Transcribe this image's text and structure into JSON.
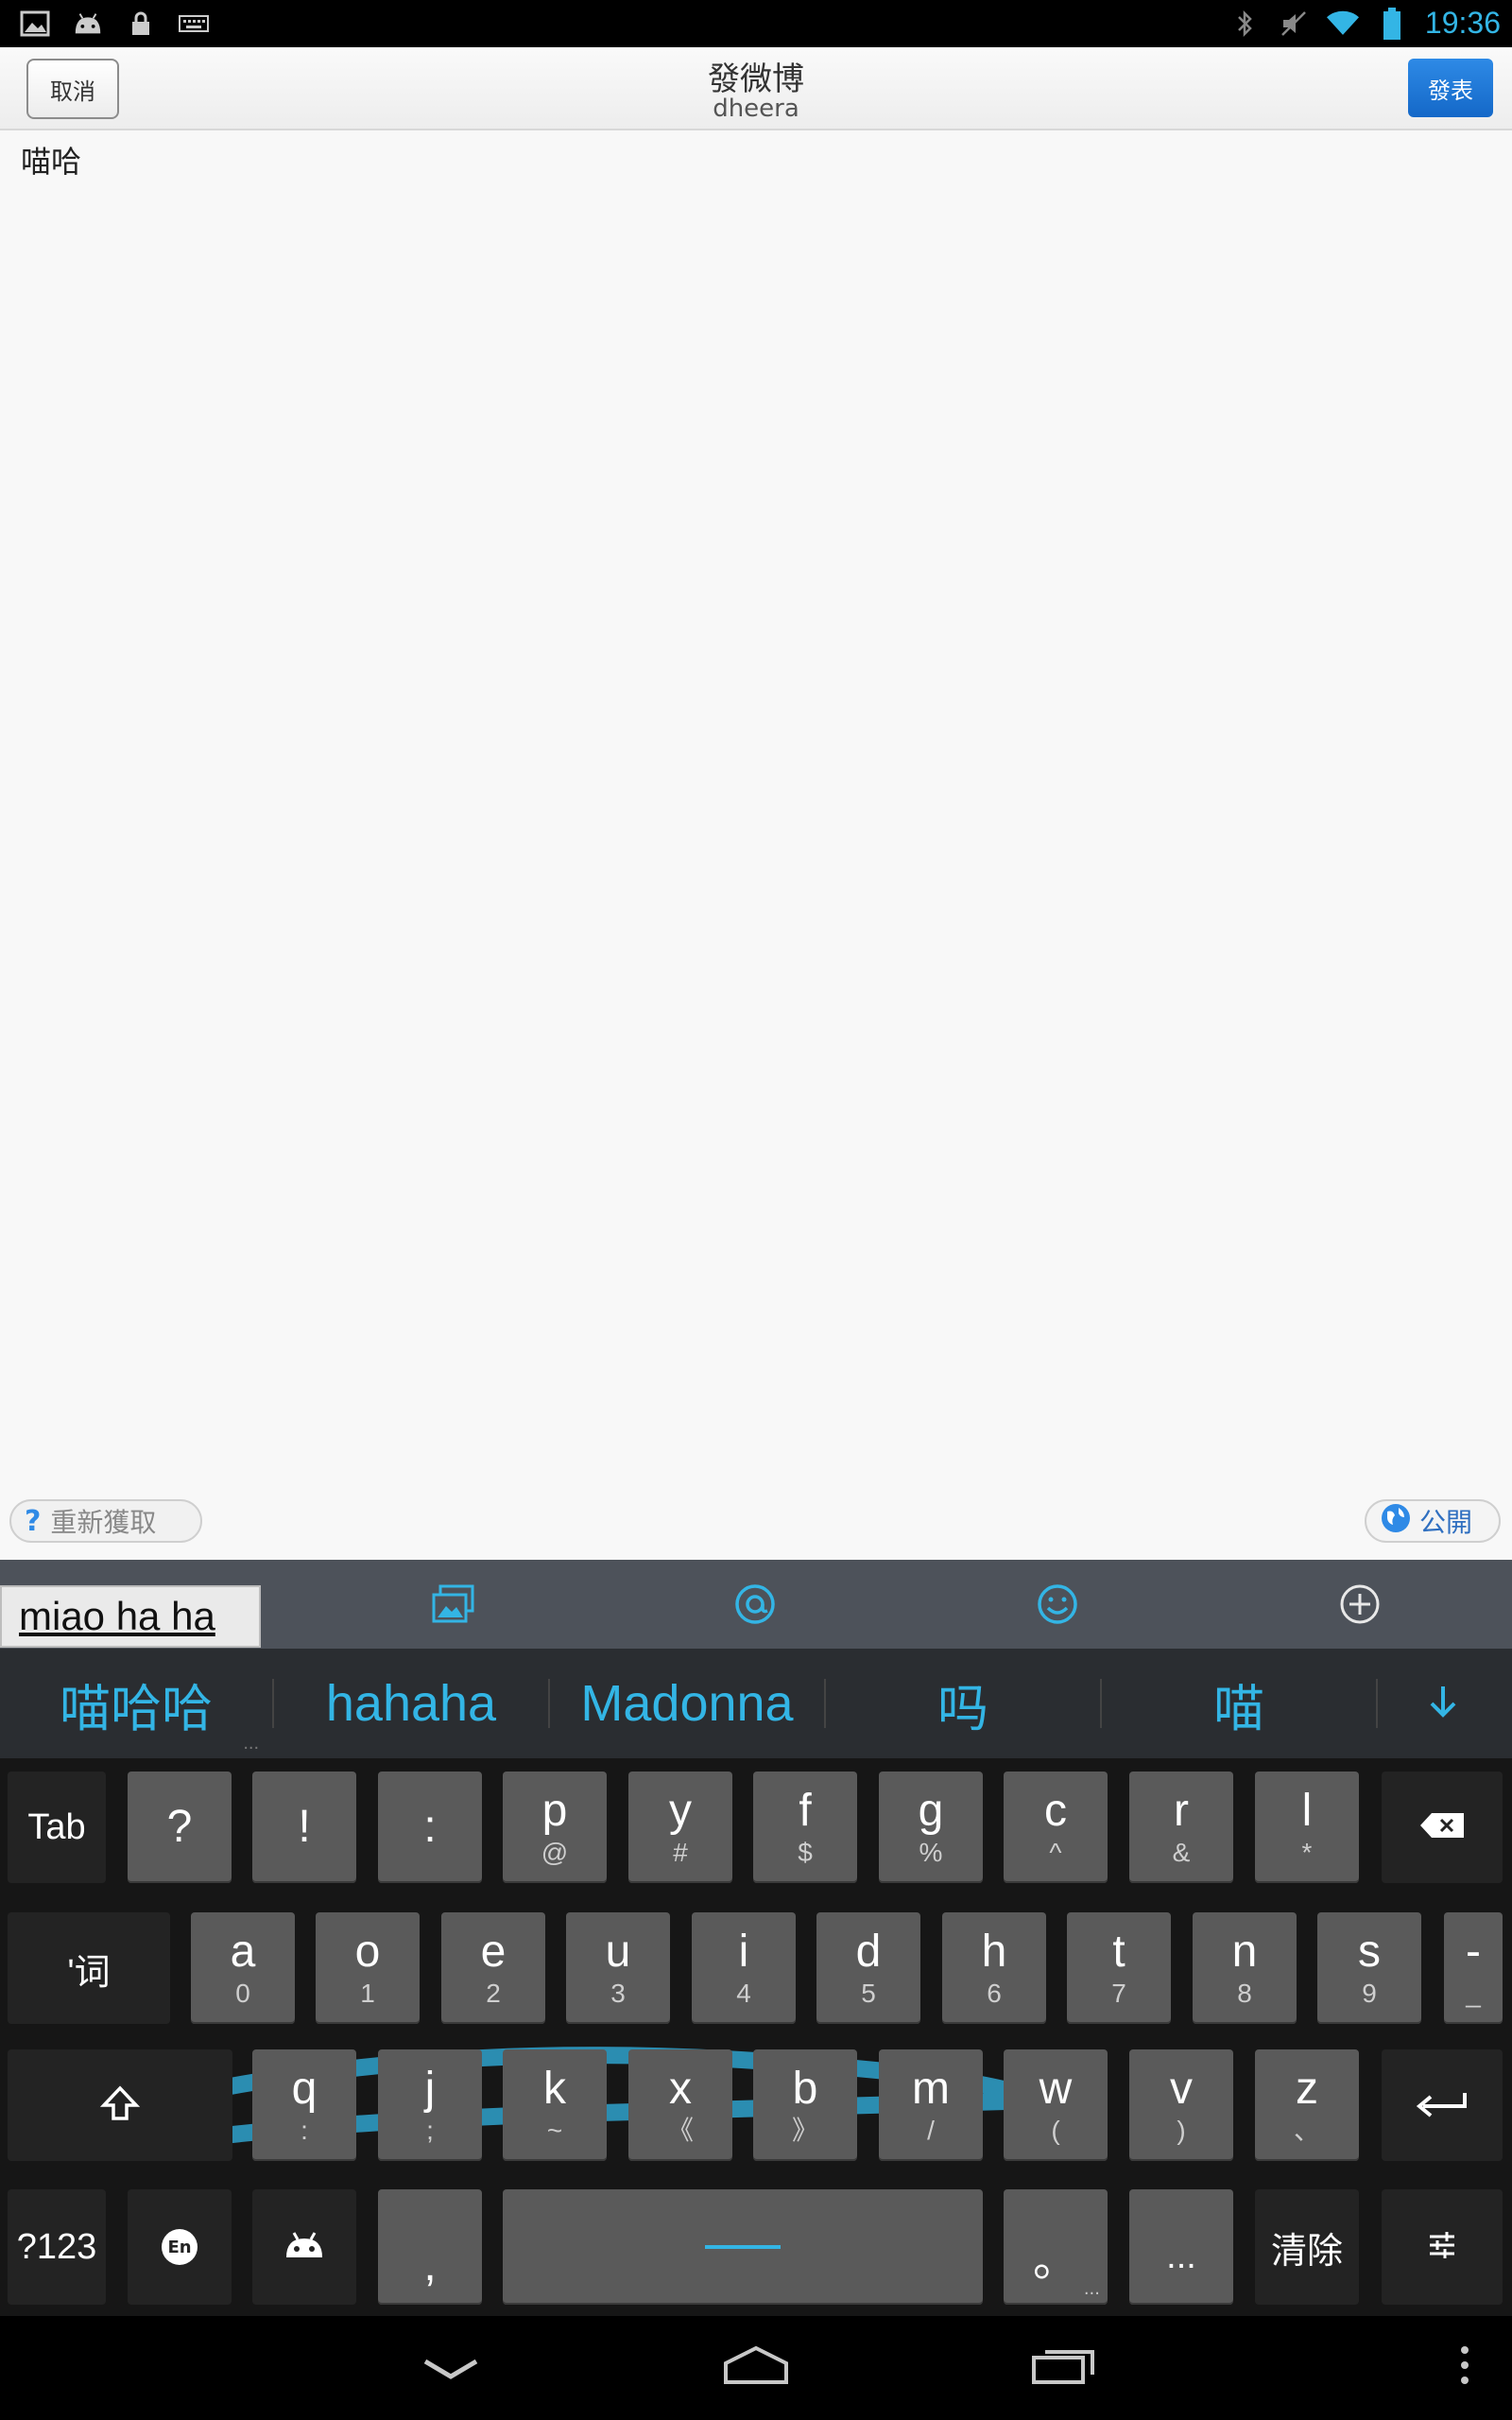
{
  "status_bar": {
    "time": "19:36",
    "left_icons": [
      "gallery-icon",
      "android-icon",
      "lock-icon",
      "keyboard-icon"
    ],
    "right_icons": [
      "bluetooth-icon",
      "mute-icon",
      "wifi-icon",
      "battery-icon"
    ]
  },
  "action_bar": {
    "cancel_label": "取消",
    "title": "發微博",
    "subtitle": "dheera",
    "post_label": "發表"
  },
  "compose": {
    "text": "喵哈"
  },
  "footer": {
    "refetch_label": "重新獲取",
    "visibility_label": "公開"
  },
  "toolbar": {
    "composing_text": "miao ha ha",
    "icons": [
      "image-icon",
      "at-icon",
      "emoji-icon",
      "plus-icon"
    ]
  },
  "candidates": {
    "items": [
      "喵哈哈",
      "hahaha",
      "Madonna",
      "吗",
      "喵"
    ],
    "more_marker": "..."
  },
  "keyboard": {
    "row1": [
      {
        "main": "Tab",
        "sub": ""
      },
      {
        "main": "?",
        "sub": ""
      },
      {
        "main": "!",
        "sub": ""
      },
      {
        "main": ":",
        "sub": ""
      },
      {
        "main": "p",
        "sub": "@"
      },
      {
        "main": "y",
        "sub": "#"
      },
      {
        "main": "f",
        "sub": "$"
      },
      {
        "main": "g",
        "sub": "%"
      },
      {
        "main": "c",
        "sub": "^"
      },
      {
        "main": "r",
        "sub": "&"
      },
      {
        "main": "l",
        "sub": "*"
      }
    ],
    "row2": [
      {
        "main": "'词",
        "sub": ""
      },
      {
        "main": "a",
        "sub": "0"
      },
      {
        "main": "o",
        "sub": "1"
      },
      {
        "main": "e",
        "sub": "2"
      },
      {
        "main": "u",
        "sub": "3"
      },
      {
        "main": "i",
        "sub": "4"
      },
      {
        "main": "d",
        "sub": "5"
      },
      {
        "main": "h",
        "sub": "6"
      },
      {
        "main": "t",
        "sub": "7"
      },
      {
        "main": "n",
        "sub": "8"
      },
      {
        "main": "s",
        "sub": "9"
      },
      {
        "main": "-",
        "sub": "_"
      }
    ],
    "row3": [
      {
        "main": "q",
        "sub": ":"
      },
      {
        "main": "j",
        "sub": ";"
      },
      {
        "main": "k",
        "sub": "~"
      },
      {
        "main": "x",
        "sub": "《"
      },
      {
        "main": "b",
        "sub": "》"
      },
      {
        "main": "m",
        "sub": "/"
      },
      {
        "main": "w",
        "sub": "("
      },
      {
        "main": "v",
        "sub": ")"
      },
      {
        "main": "z",
        "sub": "、"
      }
    ],
    "symbols_label": "?123",
    "lang_label": "En",
    "comma_label": ",",
    "period_label": "。",
    "ellipsis_label": "...",
    "clear_label": "清除",
    "period_more": "..."
  },
  "nav_bar": {
    "icons": [
      "back-icon",
      "home-icon",
      "recents-icon",
      "menu-icon"
    ]
  },
  "colors": {
    "accent": "#33b5e5",
    "post_button": "#1e78d8",
    "keyboard_bg": "#161616",
    "key_bg": "#5a5a5a"
  }
}
